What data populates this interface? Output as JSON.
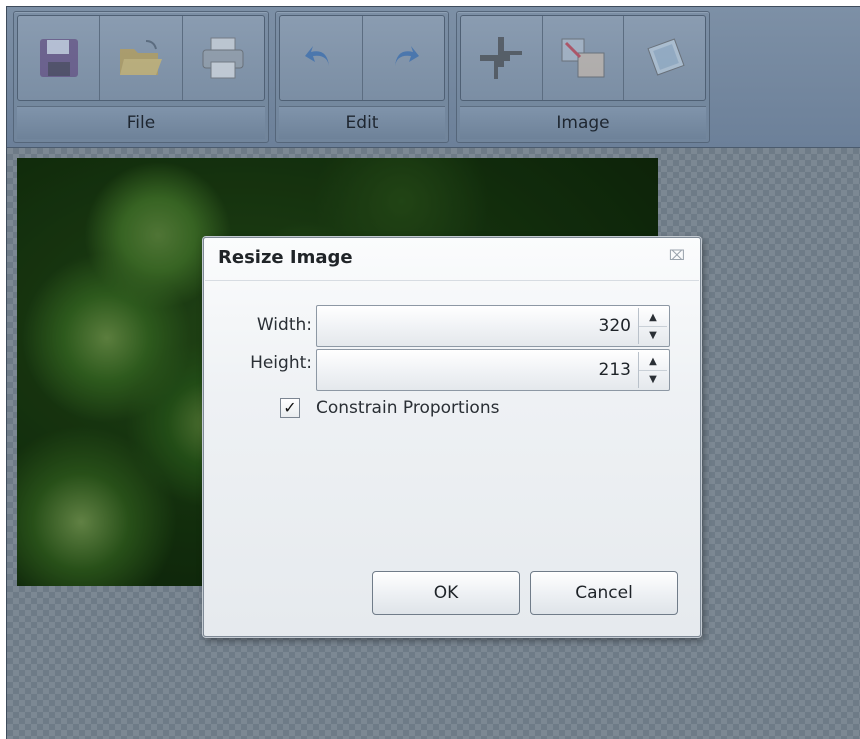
{
  "toolbar": {
    "groups": [
      {
        "label": "File",
        "buttons": [
          "save-icon",
          "open-folder-icon",
          "print-icon"
        ]
      },
      {
        "label": "Edit",
        "buttons": [
          "undo-icon",
          "redo-icon"
        ]
      },
      {
        "label": "Image",
        "buttons": [
          "crop-icon",
          "resize-icon",
          "rotate-icon"
        ]
      }
    ]
  },
  "dialog": {
    "title": "Resize Image",
    "close_icon": "close-icon",
    "width_label": "Width:",
    "width_value": "320",
    "height_label": "Height:",
    "height_value": "213",
    "constrain_label": "Constrain Proportions",
    "constrain_checked": true,
    "ok_label": "OK",
    "cancel_label": "Cancel"
  }
}
